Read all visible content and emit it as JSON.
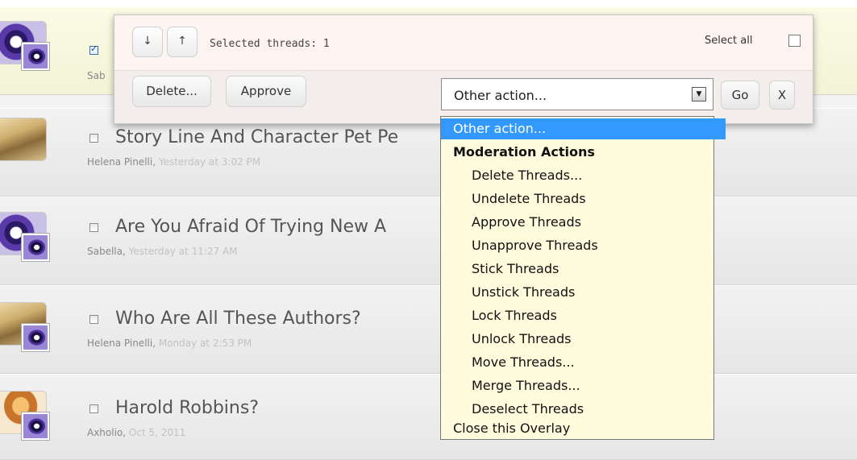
{
  "threads": [
    {
      "title": "",
      "author": "Sab",
      "date": "",
      "checked": true,
      "avatar": "eye-avatar"
    },
    {
      "title": "Story Line And Character Pet Pe",
      "author": "Helena Pinelli,",
      "date": " Yesterday at 3:02 PM",
      "checked": false,
      "avatar": "book-reader-avatar"
    },
    {
      "title": "Are You Afraid Of Trying New A",
      "author": "Sabella,",
      "date": " Yesterday at 11:27 AM",
      "checked": false,
      "avatar": "eye-avatar"
    },
    {
      "title": "Who Are All These Authors?",
      "author": "Helena Pinelli,",
      "date": " Monday at 2:53 PM",
      "checked": false,
      "avatar": "book-reader-avatar"
    },
    {
      "title": "Harold Robbins?",
      "author": "Axholio,",
      "date": " Oct 5, 2011",
      "checked": false,
      "avatar": "figure-avatar"
    }
  ],
  "overlay": {
    "down_icon": "↓",
    "up_icon": "↑",
    "selected_text": "Selected threads: 1",
    "select_all_label": "Select all",
    "delete_label": "Delete...",
    "approve_label": "Approve",
    "action_select_value": "Other action...",
    "go_label": "Go",
    "close_label": "X"
  },
  "menu": {
    "selected": "Other action...",
    "group_header": "Moderation Actions",
    "items": [
      "Delete Threads...",
      "Undelete Threads",
      "Approve Threads",
      "Unapprove Threads",
      "Stick Threads",
      "Unstick Threads",
      "Lock Threads",
      "Unlock Threads",
      "Move Threads...",
      "Merge Threads...",
      "Deselect Threads"
    ],
    "footer": "Close this Overlay"
  },
  "colors": {
    "highlight": "#3399ff",
    "menu_bg": "#fffbdd",
    "overlay_top": "#fdf4f1"
  }
}
